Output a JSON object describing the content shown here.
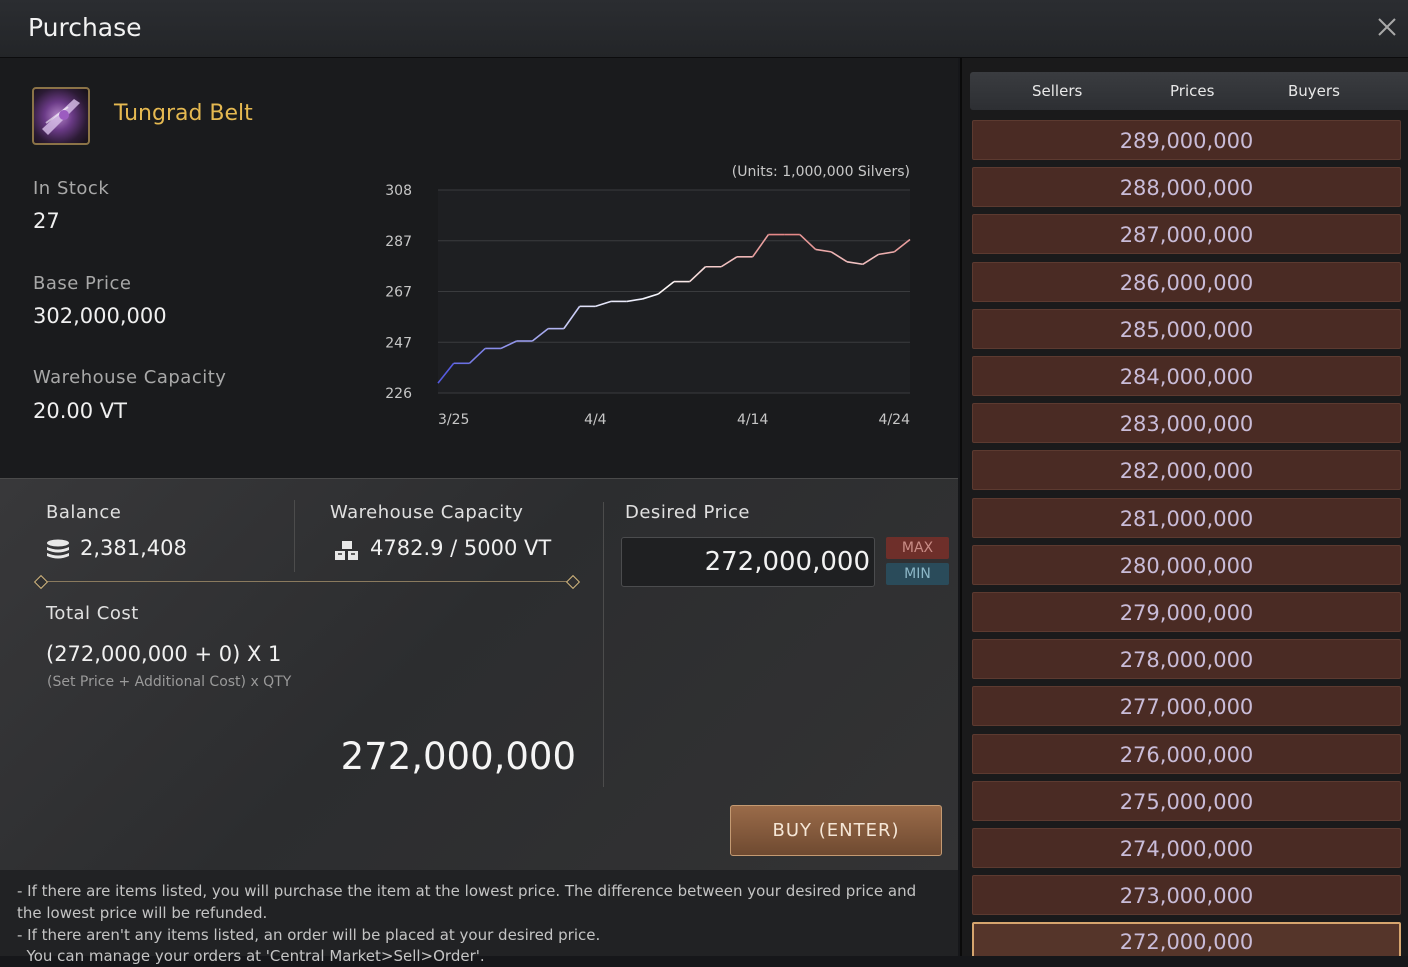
{
  "window": {
    "title": "Purchase"
  },
  "item": {
    "name": "Tungrad Belt",
    "in_stock_label": "In Stock",
    "in_stock_value": "27",
    "base_price_label": "Base Price",
    "base_price_value": "302,000,000",
    "warehouse_label": "Warehouse Capacity",
    "warehouse_value": "20.00 VT"
  },
  "chart_data": {
    "type": "line",
    "title": "",
    "units_note": "(Units: 1,000,000 Silvers)",
    "x_tick_labels": [
      "3/25",
      "4/4",
      "4/14",
      "4/24"
    ],
    "y_tick_labels": [
      "308",
      "287",
      "267",
      "247",
      "226"
    ],
    "ylim": [
      226,
      308
    ],
    "x": [
      "3/25",
      "3/26",
      "3/27",
      "3/28",
      "3/29",
      "3/30",
      "3/31",
      "4/1",
      "4/2",
      "4/3",
      "4/4",
      "4/5",
      "4/6",
      "4/7",
      "4/8",
      "4/9",
      "4/10",
      "4/11",
      "4/12",
      "4/13",
      "4/14",
      "4/15",
      "4/16",
      "4/17",
      "4/18",
      "4/19",
      "4/20",
      "4/21",
      "4/22",
      "4/23",
      "4/24"
    ],
    "values": [
      230,
      238,
      238,
      244,
      244,
      247,
      247,
      252,
      252,
      261,
      261,
      263,
      263,
      264,
      266,
      271,
      271,
      277,
      277,
      281,
      281,
      290,
      290,
      290,
      284,
      283,
      279,
      278,
      282,
      283,
      288
    ],
    "series_colors": {
      "rising": "#2d33d8",
      "falling": "#d02a2a",
      "mid": "#ffffff"
    },
    "grid": true
  },
  "purchase": {
    "balance_label": "Balance",
    "balance_value": "2,381,408",
    "warehouse_label": "Warehouse Capacity",
    "warehouse_value": "4782.9 / 5000 VT",
    "total_cost_label": "Total Cost",
    "formula": "(272,000,000 + 0) X 1",
    "formula_hint": "(Set Price + Additional Cost) x QTY",
    "total": "272,000,000",
    "desired_price_label": "Desired Price",
    "desired_price_value": "272,000,000",
    "max_label": "MAX",
    "min_label": "MIN",
    "buy_label": "BUY (ENTER)"
  },
  "notes": [
    "- If there are items listed, you will purchase the item at the lowest price. The difference between your desired price and the lowest price will be refunded.",
    "- If there aren't any items listed, an order will be placed at your desired price.",
    "  You can manage your orders at 'Central Market>Sell>Order'."
  ],
  "price_list": {
    "tabs": [
      "Sellers",
      "Prices",
      "Buyers"
    ],
    "rows": [
      "289,000,000",
      "288,000,000",
      "287,000,000",
      "286,000,000",
      "285,000,000",
      "284,000,000",
      "283,000,000",
      "282,000,000",
      "281,000,000",
      "280,000,000",
      "279,000,000",
      "278,000,000",
      "277,000,000",
      "276,000,000",
      "275,000,000",
      "274,000,000",
      "273,000,000",
      "272,000,000"
    ],
    "selected_index": 17
  }
}
